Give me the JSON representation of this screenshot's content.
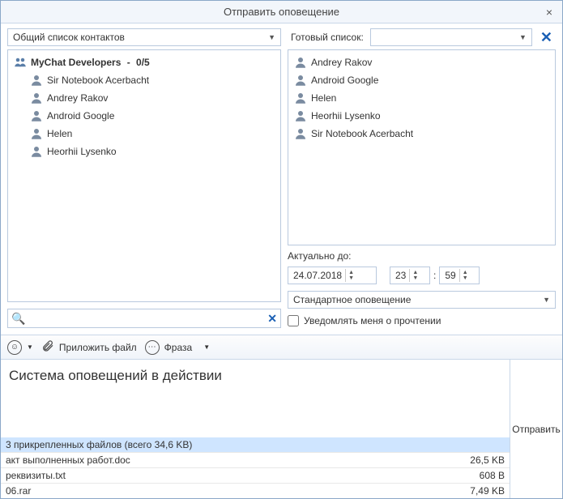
{
  "window": {
    "title": "Отправить оповещение",
    "close": "×"
  },
  "contactsCombo": "Общий список контактов",
  "readyListLabel": "Готовый список:",
  "group": {
    "name": "MyChat Developers",
    "count": "0/5"
  },
  "contacts": [
    "Sir Notebook Acerbacht",
    "Andrey Rakov",
    "Android Google",
    "Helen",
    "Heorhii Lysenko"
  ],
  "selectedContacts": [
    "Andrey Rakov",
    "Android Google",
    "Helen",
    "Heorhii Lysenko",
    "Sir Notebook Acerbacht"
  ],
  "validUntilLabel": "Актуально до:",
  "validDate": "24.07.2018",
  "hour": "23",
  "minute": "59",
  "colon": ":",
  "notificationType": "Стандартное оповещение",
  "notifyReadLabel": "Уведомлять меня о прочтении",
  "attachLabel": "Приложить файл",
  "phraseLabel": "Фраза",
  "msgText": "Система оповещений в действии",
  "filesSummary": "3 прикрепленных файлов (всего 34,6 KB)",
  "files": [
    {
      "name": "акт выполненных работ.doc",
      "size": "26,5 KB"
    },
    {
      "name": "реквизиты.txt",
      "size": "608 B"
    },
    {
      "name": "06.rar",
      "size": "7,49 KB"
    }
  ],
  "sendLabel": "Отправить"
}
